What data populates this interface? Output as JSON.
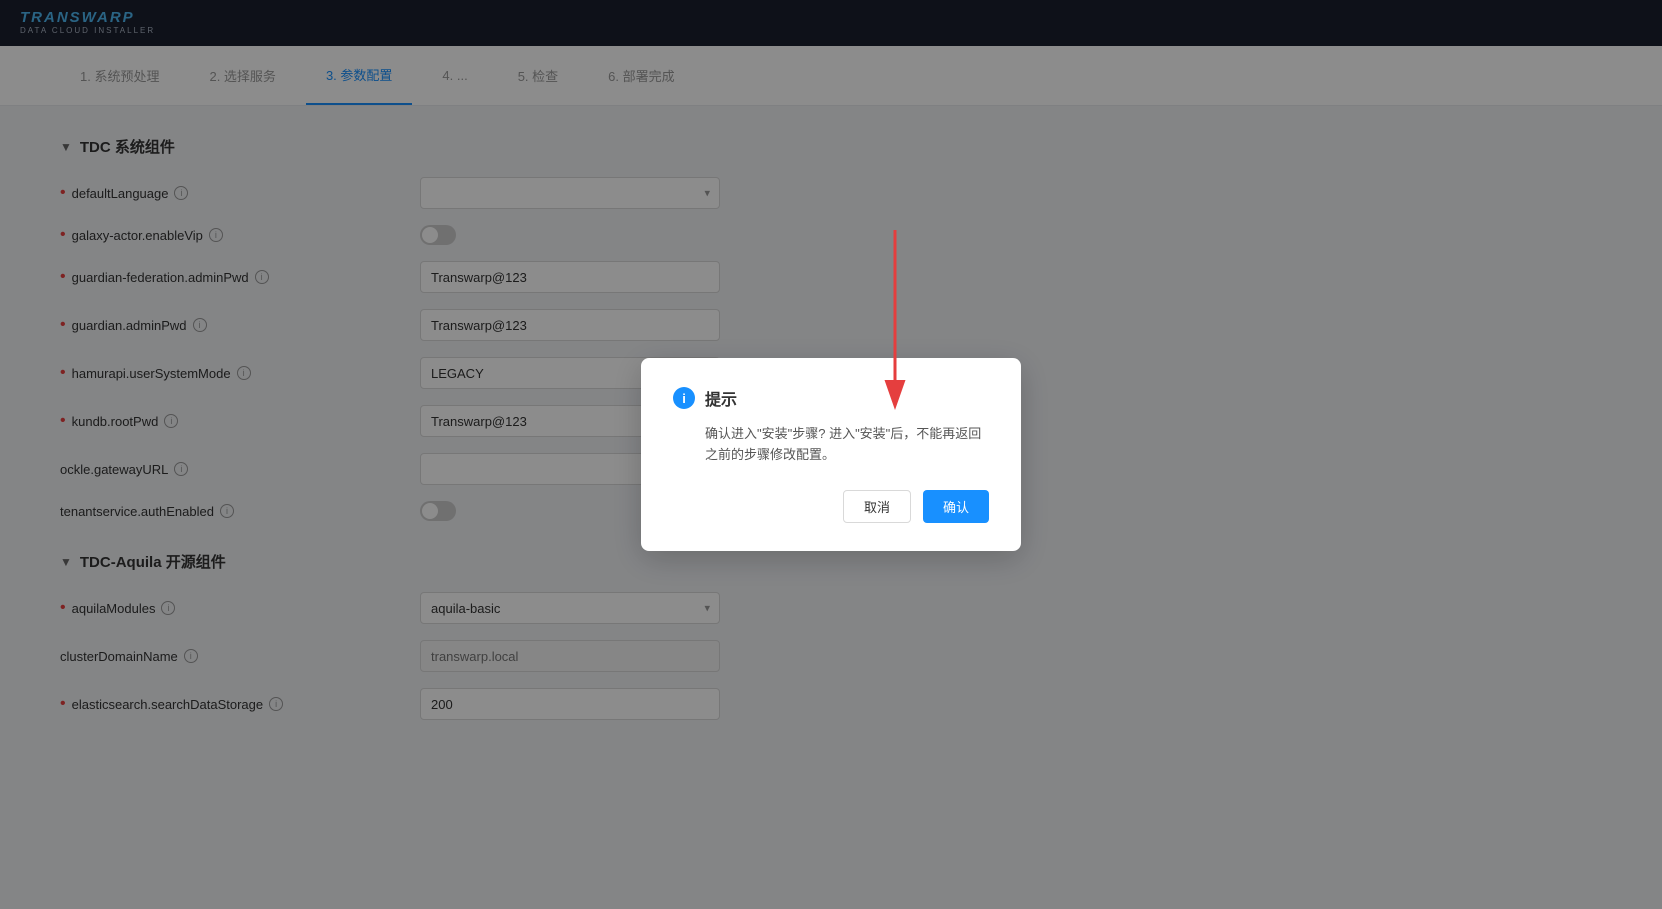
{
  "header": {
    "logo_top_part1": "TRANS",
    "logo_top_part2": "WARP",
    "logo_bottom": "DATA CLOUD INSTALLER"
  },
  "stepper": {
    "steps": [
      {
        "id": "step1",
        "label": "1. 系统预处理",
        "active": false
      },
      {
        "id": "step2",
        "label": "2. 选择服务",
        "active": false
      },
      {
        "id": "step3",
        "label": "3. 参数配置",
        "active": true
      },
      {
        "id": "step4",
        "label": "4. ...",
        "active": false
      },
      {
        "id": "step5",
        "label": "5. 检查",
        "active": false
      },
      {
        "id": "step6",
        "label": "6. 部署完成",
        "active": false
      }
    ]
  },
  "sections": [
    {
      "id": "tdc-system",
      "title": "TDC 系统组件",
      "fields": [
        {
          "id": "defaultLanguage",
          "label": "defaultLanguage",
          "required": true,
          "type": "select",
          "value": "",
          "options": []
        },
        {
          "id": "galaxyActorEnableVip",
          "label": "galaxy-actor.enableVip",
          "required": true,
          "type": "toggle",
          "value": false
        },
        {
          "id": "guardianFederationAdminPwd",
          "label": "guardian-federation.adminPwd",
          "required": true,
          "type": "input",
          "value": "Transwarp@123"
        },
        {
          "id": "guardianAdminPwd",
          "label": "guardian.adminPwd",
          "required": true,
          "type": "input",
          "value": "Transwarp@123"
        },
        {
          "id": "hamurapiUserSystemMode",
          "label": "hamurapi.userSystemMode",
          "required": true,
          "type": "select",
          "value": "LEGACY",
          "options": [
            "LEGACY"
          ]
        },
        {
          "id": "kundbRootPwd",
          "label": "kundb.rootPwd",
          "required": true,
          "type": "input",
          "value": "Transwarp@123"
        },
        {
          "id": "ockleGatewayURL",
          "label": "ockle.gatewayURL",
          "required": false,
          "type": "input",
          "value": ""
        },
        {
          "id": "tenantserviceAuthEnabled",
          "label": "tenantservice.authEnabled",
          "required": false,
          "type": "toggle",
          "value": false
        }
      ]
    },
    {
      "id": "tdc-aquila",
      "title": "TDC-Aquila 开源组件",
      "fields": [
        {
          "id": "aquilaModules",
          "label": "aquilaModules",
          "required": true,
          "type": "select",
          "value": "aquila-basic",
          "options": [
            "aquila-basic"
          ]
        },
        {
          "id": "clusterDomainName",
          "label": "clusterDomainName",
          "required": false,
          "type": "input",
          "value": "",
          "placeholder": "transwarp.local"
        },
        {
          "id": "elasticsearchSearchDataStorage",
          "label": "elasticsearch.searchDataStorage",
          "required": true,
          "type": "input",
          "value": "200"
        }
      ]
    }
  ],
  "dialog": {
    "title": "提示",
    "message_line1": "确认进入\"安装\"步骤? 进入\"安装\"后，不能再返回",
    "message_line2": "之前的步骤修改配置。",
    "cancel_label": "取消",
    "confirm_label": "确认"
  }
}
